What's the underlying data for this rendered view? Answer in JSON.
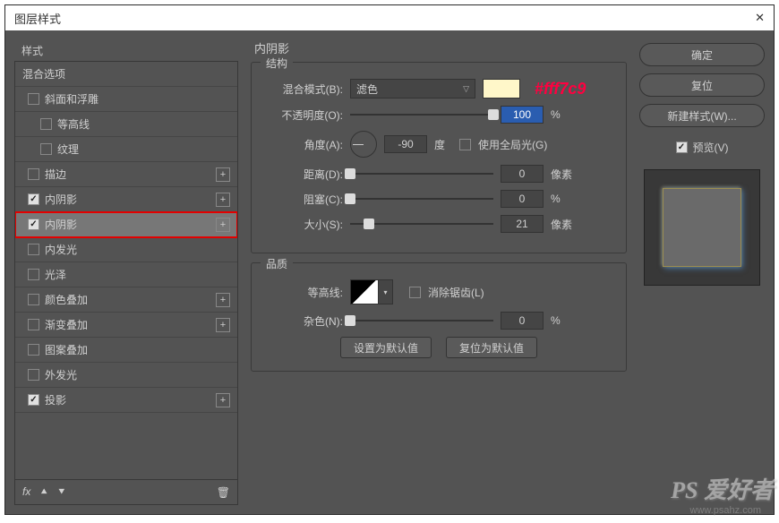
{
  "window": {
    "title": "图层样式",
    "close": "✕"
  },
  "left": {
    "header": "样式",
    "blending": "混合选项",
    "items": [
      {
        "label": "斜面和浮雕",
        "checked": false,
        "plus": false
      },
      {
        "label": "等高线",
        "checked": false,
        "plus": false,
        "sub": true
      },
      {
        "label": "纹理",
        "checked": false,
        "plus": false,
        "sub": true
      },
      {
        "label": "描边",
        "checked": false,
        "plus": true
      },
      {
        "label": "内阴影",
        "checked": true,
        "plus": true
      },
      {
        "label": "内阴影",
        "checked": true,
        "plus": true,
        "selected": true,
        "highlight": true
      },
      {
        "label": "内发光",
        "checked": false,
        "plus": false
      },
      {
        "label": "光泽",
        "checked": false,
        "plus": false
      },
      {
        "label": "颜色叠加",
        "checked": false,
        "plus": true
      },
      {
        "label": "渐变叠加",
        "checked": false,
        "plus": true
      },
      {
        "label": "图案叠加",
        "checked": false,
        "plus": false
      },
      {
        "label": "外发光",
        "checked": false,
        "plus": false
      },
      {
        "label": "投影",
        "checked": true,
        "plus": true
      }
    ],
    "footer_fx": "fx"
  },
  "center": {
    "title": "内阴影",
    "group_structure": "结构",
    "blend_mode_label": "混合模式(B):",
    "blend_mode_value": "滤色",
    "color_hex_annotation": "#fff7c9",
    "opacity_label": "不透明度(O):",
    "opacity_value": "100",
    "opacity_unit": "%",
    "angle_label": "角度(A):",
    "angle_value": "-90",
    "angle_unit": "度",
    "global_light_label": "使用全局光(G)",
    "distance_label": "距离(D):",
    "distance_value": "0",
    "distance_unit": "像素",
    "choke_label": "阻塞(C):",
    "choke_value": "0",
    "choke_unit": "%",
    "size_label": "大小(S):",
    "size_value": "21",
    "size_unit": "像素",
    "group_quality": "品质",
    "contour_label": "等高线:",
    "antialias_label": "消除锯齿(L)",
    "noise_label": "杂色(N):",
    "noise_value": "0",
    "noise_unit": "%",
    "btn_default": "设置为默认值",
    "btn_reset": "复位为默认值"
  },
  "right": {
    "ok": "确定",
    "cancel": "复位",
    "new_style": "新建样式(W)...",
    "preview_label": "预览(V)"
  },
  "watermark": {
    "logo": "PS 爱好者",
    "url": "www.psahz.com"
  }
}
